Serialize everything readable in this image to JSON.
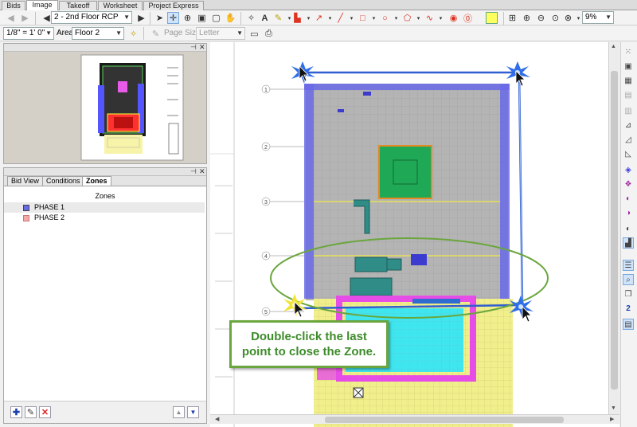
{
  "tabs": [
    "Bids",
    "Image",
    "Takeoff",
    "Worksheet",
    "Project Express"
  ],
  "toolbar": {
    "page_selector": "2 - 2nd Floor RCP",
    "zoom_level": "9%",
    "scale": "1/8\" = 1' 0\"",
    "area_label": "Area",
    "area_value": "Floor 2",
    "page_size_label": "Page Size",
    "page_size_value": "Letter"
  },
  "left_panel": {
    "tabs": [
      "Bid View",
      "Conditions",
      "Zones"
    ],
    "zones_header": "Zones",
    "zones": [
      {
        "name": "PHASE 1",
        "color": "#6a6ae8",
        "selected": true
      },
      {
        "name": "PHASE 2",
        "color": "#f4a8a8",
        "selected": false
      }
    ]
  },
  "drawing": {
    "grid_labels": [
      "1",
      "2",
      "3",
      "4",
      "5"
    ],
    "callout_text": "Double-click the last point to close the Zone."
  },
  "colors": {
    "zone_outline": "#2f5fd0",
    "phase1": "#6a6ae8",
    "magenta": "#e64ce6",
    "cyan": "#3fe6f0",
    "green_room": "#1fa855",
    "yellow": "#f1ee8c",
    "callout_border": "#6aa63d",
    "callout_text": "#3d8b2a"
  }
}
